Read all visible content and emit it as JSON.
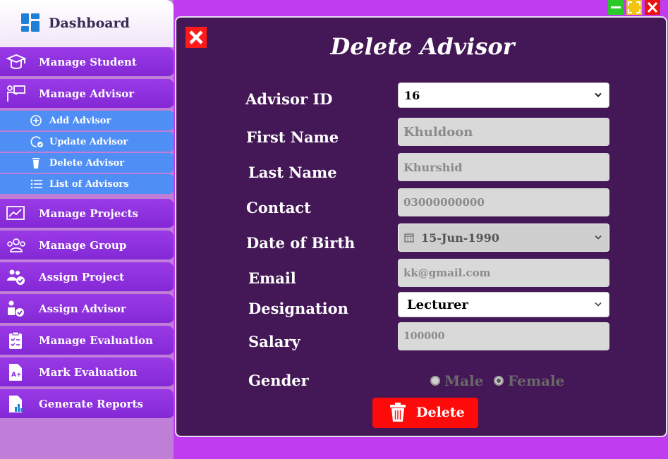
{
  "sidebar": {
    "title": "Dashboard",
    "items": [
      {
        "label": "Manage Student",
        "icon": "graduation-cap-icon"
      },
      {
        "label": "Manage Advisor",
        "icon": "teacher-board-icon"
      },
      {
        "label": "Manage Projects",
        "icon": "chart-image-icon"
      },
      {
        "label": "Manage Group",
        "icon": "group-icon"
      },
      {
        "label": "Assign Project",
        "icon": "users-check-icon"
      },
      {
        "label": "Assign Advisor",
        "icon": "user-check-icon"
      },
      {
        "label": "Manage Evaluation",
        "icon": "clipboard-check-icon"
      },
      {
        "label": "Mark Evaluation",
        "icon": "grade-document-icon"
      },
      {
        "label": "Generate Reports",
        "icon": "report-icon"
      }
    ],
    "sub_items": [
      {
        "label": "Add Advisor",
        "icon": "plus-circle-icon"
      },
      {
        "label": "Update Advisor",
        "icon": "refresh-check-icon"
      },
      {
        "label": "Delete Advisor",
        "icon": "trash-icon"
      },
      {
        "label": "List of Advisors",
        "icon": "list-icon"
      }
    ]
  },
  "window": {
    "controls": [
      "minimize",
      "maximize",
      "close"
    ]
  },
  "form": {
    "title": "Delete Advisor",
    "labels": {
      "advisor_id": "Advisor ID",
      "first_name": "First Name",
      "last_name": "Last Name",
      "contact": "Contact",
      "dob": "Date of Birth",
      "email": "Email",
      "designation": "Designation",
      "salary": "Salary",
      "gender": "Gender"
    },
    "values": {
      "advisor_id": "16",
      "first_name": "Khuldoon",
      "last_name": "Khurshid",
      "contact": "03000000000",
      "dob": "15-Jun-1990",
      "email": "kk@gmail.com",
      "designation": "Lecturer",
      "salary": "100000"
    },
    "gender_options": [
      "Male",
      "Female"
    ],
    "gender_selected": "Female",
    "delete_label": "Delete"
  },
  "colors": {
    "background": "#c03cf0",
    "panel": "#441756",
    "nav": "#8a2be2",
    "sub_nav": "#4f8ff5",
    "delete": "#ff0a0a"
  }
}
